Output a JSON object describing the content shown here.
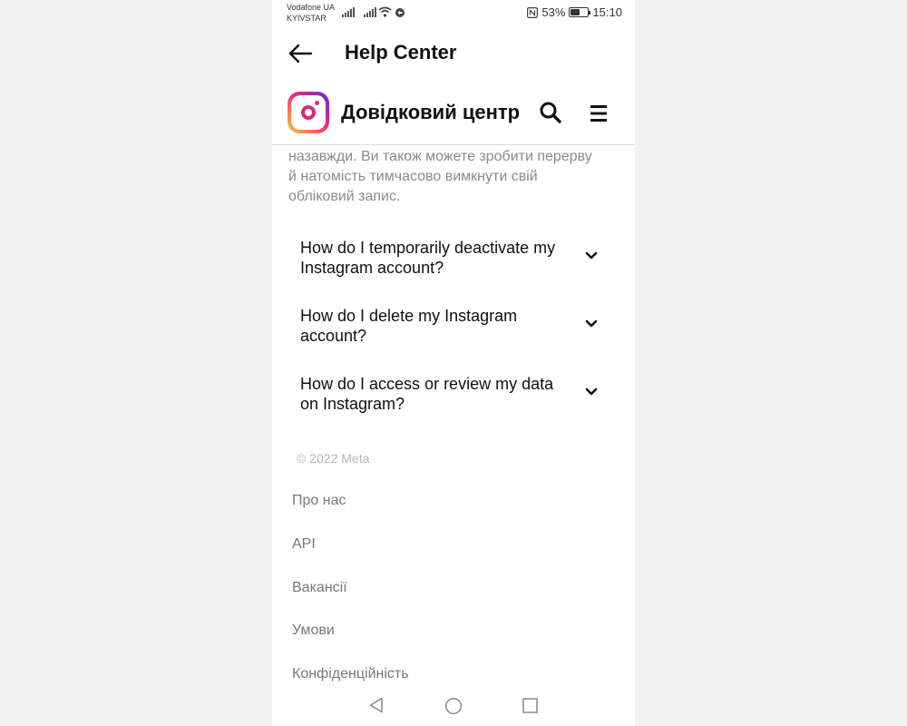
{
  "status_bar": {
    "carrier1": "Vodafone UA",
    "carrier2": "KYIVSTAR",
    "battery_text": "53%",
    "battery_level": 0.53,
    "time": "15:10",
    "icons": [
      "signal-icon",
      "signal-icon",
      "wifi-icon",
      "data-saver-icon",
      "nfc-icon",
      "battery-icon"
    ]
  },
  "app_bar": {
    "title": "Help Center",
    "back_icon": "arrow-left-icon"
  },
  "help_header": {
    "logo": "instagram-logo",
    "title": "Довідковий центр",
    "search_icon": "search-icon",
    "menu_icon": "menu-icon"
  },
  "content": {
    "intro_lines": [
      "назавжди. Ви також можете зробити перерву",
      "й натомість тимчасово вимкнути свій",
      "обліковий запис."
    ],
    "faqs": [
      {
        "lines": [
          "How do I temporarily deactivate my",
          "Instagram account?"
        ]
      },
      {
        "lines": [
          "How do I delete my Instagram",
          "account?"
        ]
      },
      {
        "lines": [
          "How do I access or review my data",
          "on Instagram?"
        ]
      }
    ],
    "copyright": "© 2022 Meta",
    "footer_links": [
      "Про нас",
      "API",
      "Вакансії",
      "Умови",
      "Конфіденційність"
    ]
  },
  "colors": {
    "background": "#f2f2f2",
    "surface": "#ffffff",
    "text_primary": "#111111",
    "text_secondary": "#8a8a8a",
    "divider": "#dcdcdc"
  }
}
